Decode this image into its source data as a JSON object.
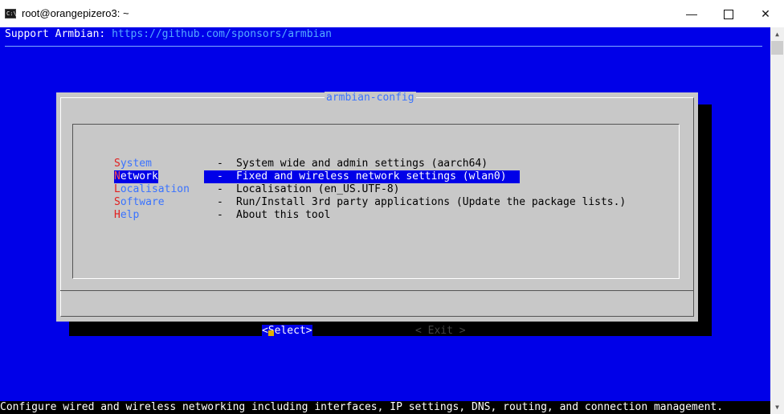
{
  "window": {
    "title": "root@orangepizero3: ~",
    "icon": "console-icon",
    "minimize_label": "—",
    "maximize_label": "",
    "close_label": "✕"
  },
  "terminal": {
    "support_prefix": "Support Armbian: ",
    "support_url": "https://github.com/sponsors/armbian",
    "status_line": "Configure wired and wireless networking including interfaces, IP settings, DNS, routing, and connection management."
  },
  "dialog": {
    "title": "armbian-config",
    "menu": [
      {
        "hot": "S",
        "rest": "ystem",
        "dash": "-",
        "desc": "System wide and admin settings (aarch64)",
        "selected": false
      },
      {
        "hot": "N",
        "rest": "etwork",
        "dash": "-",
        "desc": "Fixed and wireless network settings (wlan0)",
        "selected": true
      },
      {
        "hot": "L",
        "rest": "ocalisation",
        "dash": "-",
        "desc": "Localisation (en_US.UTF-8)",
        "selected": false
      },
      {
        "hot": "S",
        "rest": "oftware",
        "dash": "-",
        "desc": "Run/Install 3rd party applications (Update the package lists.)",
        "selected": false
      },
      {
        "hot": "H",
        "rest": "elp",
        "dash": "-",
        "desc": "About this tool",
        "selected": false
      }
    ],
    "select_button": "<Select>",
    "exit_button": "< Exit >"
  },
  "colors": {
    "terminal_bg": "#0000e8",
    "dialog_bg": "#c8c8c8",
    "tag_color": "#3a73ff",
    "hotkey_color": "#e02020"
  }
}
